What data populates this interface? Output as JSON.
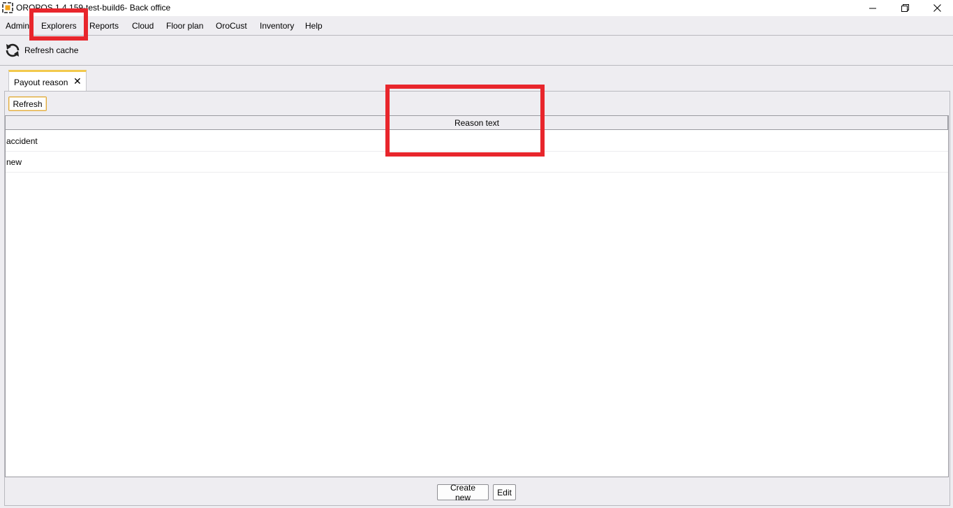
{
  "window": {
    "title": "OROPOS 1.4.159-test-build6- Back office",
    "controls": {
      "minimize": "–",
      "restore": "❐",
      "close": "✕"
    },
    "logo_icon": "app-logo-icon"
  },
  "menu": {
    "items": [
      {
        "label": "Admin"
      },
      {
        "label": "Explorers"
      },
      {
        "label": "Reports"
      },
      {
        "label": "Cloud"
      },
      {
        "label": "Floor plan"
      },
      {
        "label": "OroCust"
      },
      {
        "label": "Inventory"
      },
      {
        "label": "Help"
      }
    ]
  },
  "toolbar": {
    "refresh_cache_label": "Refresh cache",
    "refresh_icon": "refresh-icon"
  },
  "tabs": [
    {
      "label": "Payout reason",
      "close": "✕",
      "active": true
    }
  ],
  "panel": {
    "refresh_label": "Refresh",
    "table": {
      "columns": [
        "Reason text"
      ],
      "rows": [
        {
          "reason": "accident"
        },
        {
          "reason": "new"
        }
      ]
    },
    "create_new_label": "Create new",
    "edit_label": "Edit"
  },
  "colors": {
    "annotation": "#e8262c",
    "tab_accent": "#f2c94c",
    "background": "#eeedf1"
  }
}
